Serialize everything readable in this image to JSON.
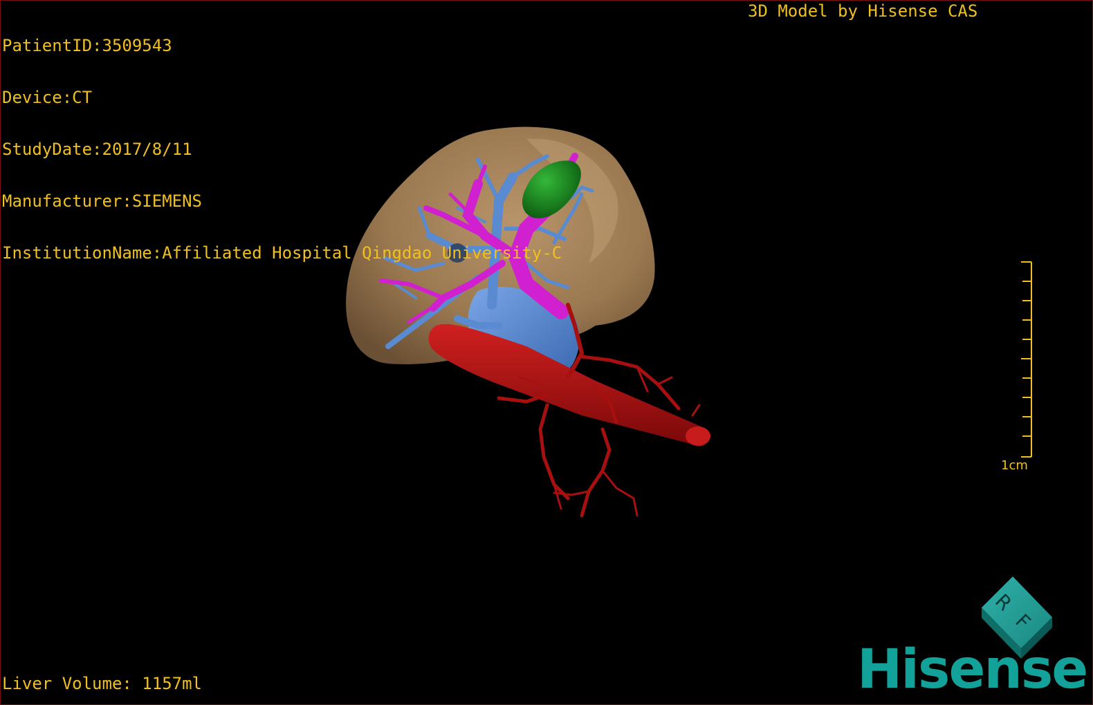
{
  "info": {
    "patient_id": "PatientID:3509543",
    "device": "Device:CT",
    "study_date": "StudyDate:2017/8/11",
    "manufacturer": "Manufacturer:SIEMENS",
    "institution": "InstitutionName:Affiliated Hospital Qingdao University-C"
  },
  "brand_caption": "3D Model by Hisense CAS",
  "scale_bar": {
    "label": "1cm"
  },
  "orientation_cube": {
    "face_letters": [
      "R",
      "F"
    ]
  },
  "footer": {
    "liver_volume": "Liver Volume: 1157ml"
  },
  "logo": {
    "text": "Hisense"
  },
  "colors": {
    "overlay_text": "#f0c020",
    "liver": "#9a7a52",
    "portal_vein": "#5a8ad0",
    "hepatic_vein": "#d020d0",
    "gallbladder": "#1c8a20",
    "artery": "#b01010",
    "logo": "#13a29a"
  }
}
